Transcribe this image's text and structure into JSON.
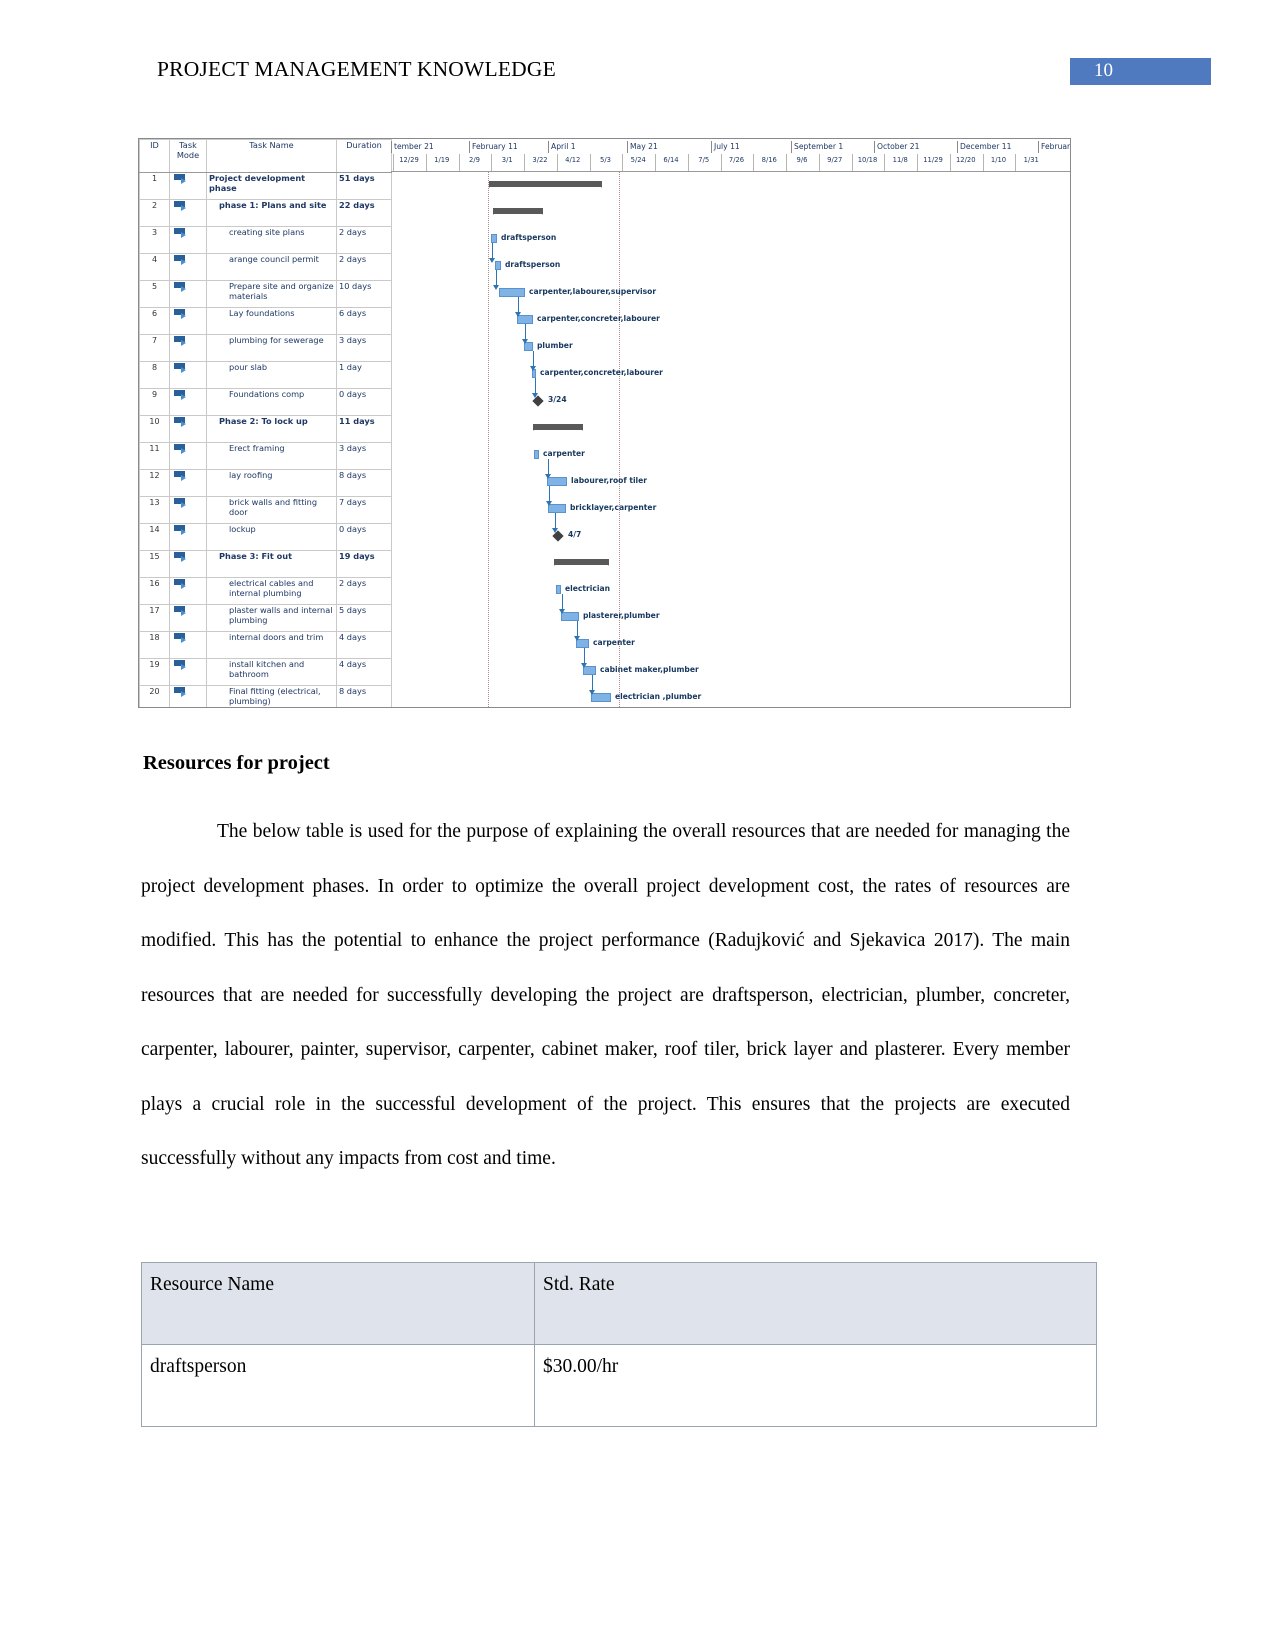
{
  "header": {
    "title": "PROJECT MANAGEMENT KNOWLEDGE",
    "page_number": "10",
    "accent_color": "#4f7ac0"
  },
  "gantt": {
    "columns": [
      "ID",
      "Task Mode",
      "Task Name",
      "Duration"
    ],
    "column_labels": {
      "id": "ID",
      "task_mode_line1": "Task",
      "task_mode_line2": "Mode",
      "task_name": "Task Name",
      "duration": "Duration"
    },
    "rows": [
      {
        "id": "1",
        "name": "Project development phase",
        "duration": "51 days",
        "level": 1
      },
      {
        "id": "2",
        "name": "phase 1: Plans and site",
        "duration": "22 days",
        "level": 2
      },
      {
        "id": "3",
        "name": "creating site plans",
        "duration": "2 days",
        "level": 3
      },
      {
        "id": "4",
        "name": "arange council permit",
        "duration": "2 days",
        "level": 3
      },
      {
        "id": "5",
        "name": "Prepare site and organize materials",
        "duration": "10 days",
        "level": 3
      },
      {
        "id": "6",
        "name": "Lay foundations",
        "duration": "6 days",
        "level": 3
      },
      {
        "id": "7",
        "name": "plumbing for sewerage",
        "duration": "3 days",
        "level": 3
      },
      {
        "id": "8",
        "name": "pour slab",
        "duration": "1 day",
        "level": 3
      },
      {
        "id": "9",
        "name": "Foundations comp",
        "duration": "0 days",
        "level": 3
      },
      {
        "id": "10",
        "name": "Phase 2: To lock up",
        "duration": "11 days",
        "level": 2
      },
      {
        "id": "11",
        "name": "Erect framing",
        "duration": "3 days",
        "level": 3
      },
      {
        "id": "12",
        "name": "lay roofing",
        "duration": "8 days",
        "level": 3
      },
      {
        "id": "13",
        "name": "brick walls and fitting door",
        "duration": "7 days",
        "level": 3
      },
      {
        "id": "14",
        "name": "lockup",
        "duration": "0 days",
        "level": 3
      },
      {
        "id": "15",
        "name": "Phase 3: Fit out",
        "duration": "19 days",
        "level": 2
      },
      {
        "id": "16",
        "name": "electrical cables and internal plumbing",
        "duration": "2 days",
        "level": 3
      },
      {
        "id": "17",
        "name": "plaster walls and internal plumbing",
        "duration": "5 days",
        "level": 3
      },
      {
        "id": "18",
        "name": "internal doors and trim",
        "duration": "4 days",
        "level": 3
      },
      {
        "id": "19",
        "name": "install kitchen and bathroom",
        "duration": "4 days",
        "level": 3
      },
      {
        "id": "20",
        "name": "Final fitting (electrical, plumbing)",
        "duration": "8 days",
        "level": 3
      }
    ],
    "timeline": {
      "months": [
        "tember 21",
        "February 11",
        "April 1",
        "May 21",
        "July 11",
        "September 1",
        "October 21",
        "December 11",
        "Februar"
      ],
      "weeks": [
        "12/29",
        "1/19",
        "2/9",
        "3/1",
        "3/22",
        "4/12",
        "5/3",
        "5/24",
        "6/14",
        "7/5",
        "7/26",
        "8/16",
        "9/6",
        "9/27",
        "10/18",
        "11/8",
        "11/29",
        "12/20",
        "1/10",
        "1/31"
      ]
    },
    "bar_labels": [
      "draftsperson",
      "draftsperson",
      "carpenter,labourer,supervisor",
      "carpenter,concreter,labourer",
      "plumber",
      "carpenter,concreter,labourer",
      "3/24",
      "carpenter",
      "labourer,roof tiler",
      "bricklayer,carpenter",
      "4/7",
      "electrician",
      "plasterer,plumber",
      "carpenter",
      "cabinet maker,plumber",
      "electrician ,plumber"
    ],
    "bar_color": "#7fb2e5",
    "summary_color": "#595959"
  },
  "section": {
    "heading": "Resources for project",
    "paragraph": "The below table is used for the purpose of explaining the overall resources that are needed for managing the project development phases. In order to optimize the overall project development cost, the rates of resources are modified. This has the potential to enhance the project performance (Radujković and Sjekavica 2017). The main resources that are needed for successfully developing the project are draftsperson, electrician, plumber, concreter, carpenter, labourer, painter, supervisor, carpenter, cabinet maker, roof tiler, brick layer and plasterer. Every member plays a crucial role in the successful development of the project. This ensures that the projects are executed successfully without any impacts from cost and time."
  },
  "resource_table": {
    "headers": [
      "Resource Name",
      "Std. Rate"
    ],
    "rows": [
      {
        "name": "draftsperson",
        "rate": "$30.00/hr"
      }
    ]
  }
}
